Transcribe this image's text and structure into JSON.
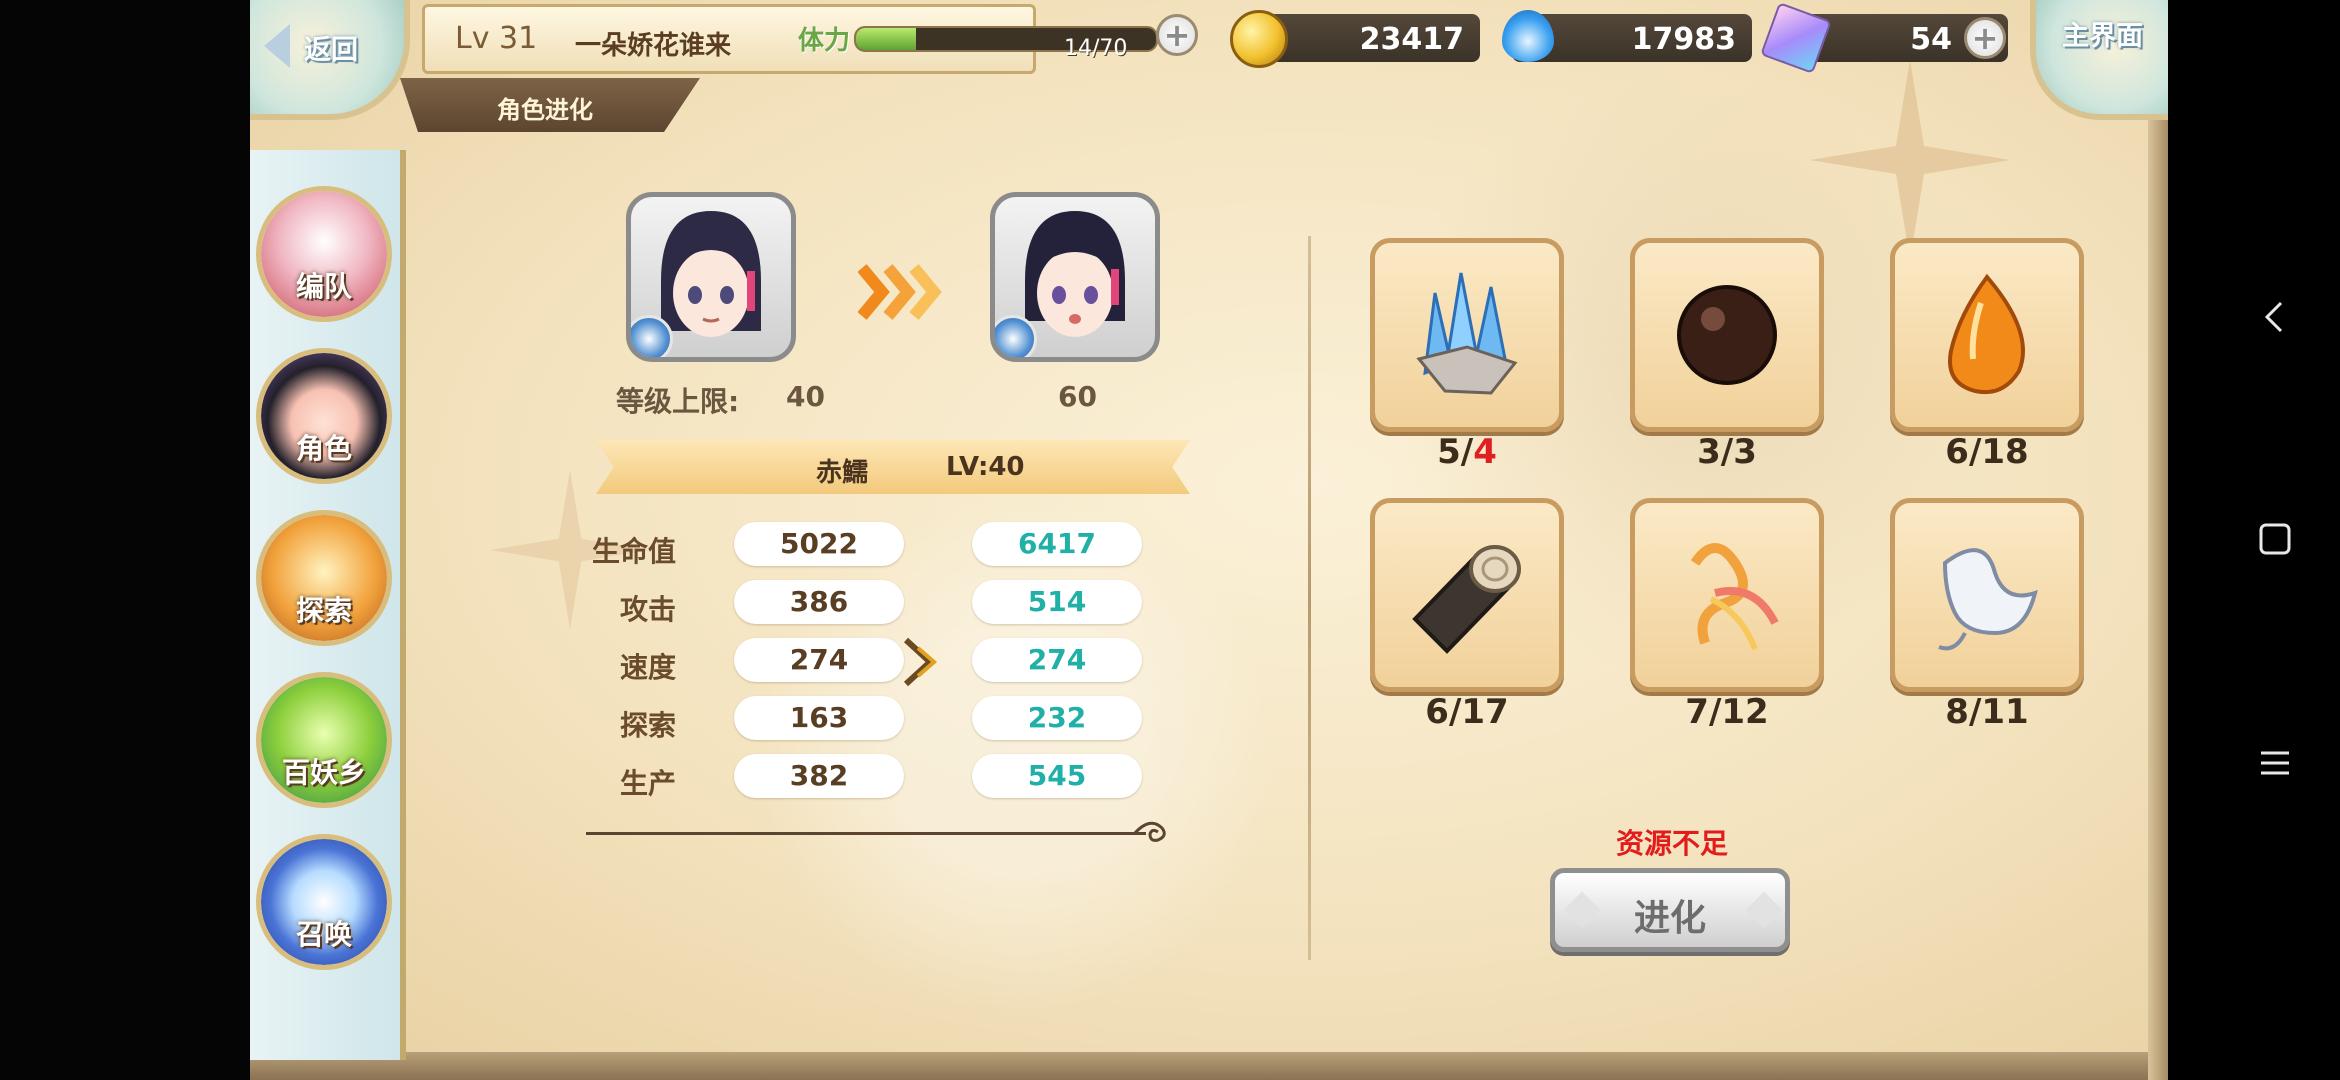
{
  "header": {
    "back_label": "返回",
    "player_level": "Lv 31",
    "player_name": "一朵娇花谁来",
    "page_title": "角色进化",
    "home_label": "主界面"
  },
  "stamina": {
    "label": "体力",
    "text": "14/70",
    "fraction": 0.2
  },
  "resources": {
    "gold": "23417",
    "soul_fire": "17983",
    "crystal": "54"
  },
  "sidebar": {
    "items": [
      {
        "label": "编队",
        "icon": "team-icon"
      },
      {
        "label": "角色",
        "icon": "character-icon"
      },
      {
        "label": "探索",
        "icon": "explore-icon"
      },
      {
        "label": "百妖乡",
        "icon": "village-icon"
      },
      {
        "label": "召唤",
        "icon": "summon-icon"
      }
    ]
  },
  "evolution": {
    "cap_label": "等级上限:",
    "cap_current": "40",
    "cap_next": "60",
    "character_name": "赤鱬",
    "character_level": "LV:40",
    "stats": [
      {
        "label": "生命值",
        "current": "5022",
        "next": "6417"
      },
      {
        "label": "攻击",
        "current": "386",
        "next": "514"
      },
      {
        "label": "速度",
        "current": "274",
        "next": "274"
      },
      {
        "label": "探索",
        "current": "163",
        "next": "232"
      },
      {
        "label": "生产",
        "current": "382",
        "next": "545"
      }
    ]
  },
  "materials": [
    {
      "icon": "ice-crystal-icon",
      "have": "5/",
      "need": "4",
      "need_color": "#e02020"
    },
    {
      "icon": "dark-orb-icon",
      "have": "3/",
      "need": "3"
    },
    {
      "icon": "fire-seed-icon",
      "have": "6/",
      "need": "18"
    },
    {
      "icon": "wood-log-icon",
      "have": "6/",
      "need": "17"
    },
    {
      "icon": "ribbon-charm-icon",
      "have": "7/",
      "need": "12"
    },
    {
      "icon": "white-spirit-icon",
      "have": "8/",
      "need": "11"
    }
  ],
  "warning": "资源不足",
  "evolve_button": "进化",
  "colors": {
    "stat_new": "#20b0a8",
    "warning": "#e21b1b"
  }
}
